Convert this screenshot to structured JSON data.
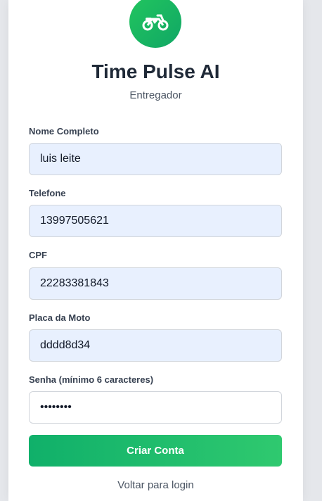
{
  "header": {
    "logo_icon": "motorcycle-icon",
    "title": "Time Pulse AI",
    "subtitle": "Entregador"
  },
  "form": {
    "full_name": {
      "label": "Nome Completo",
      "value": "luis leite"
    },
    "phone": {
      "label": "Telefone",
      "value": "13997505621"
    },
    "cpf": {
      "label": "CPF",
      "value": "22283381843"
    },
    "plate": {
      "label": "Placa da Moto",
      "value": "dddd8d34"
    },
    "password": {
      "label": "Senha (mínimo 6 caracteres)",
      "value": "••••••••"
    },
    "submit_label": "Criar Conta",
    "back_link": "Voltar para login"
  },
  "colors": {
    "accent_start": "#10b06a",
    "accent_end": "#2fc96f",
    "autofill_background": "#e8f0fe"
  }
}
